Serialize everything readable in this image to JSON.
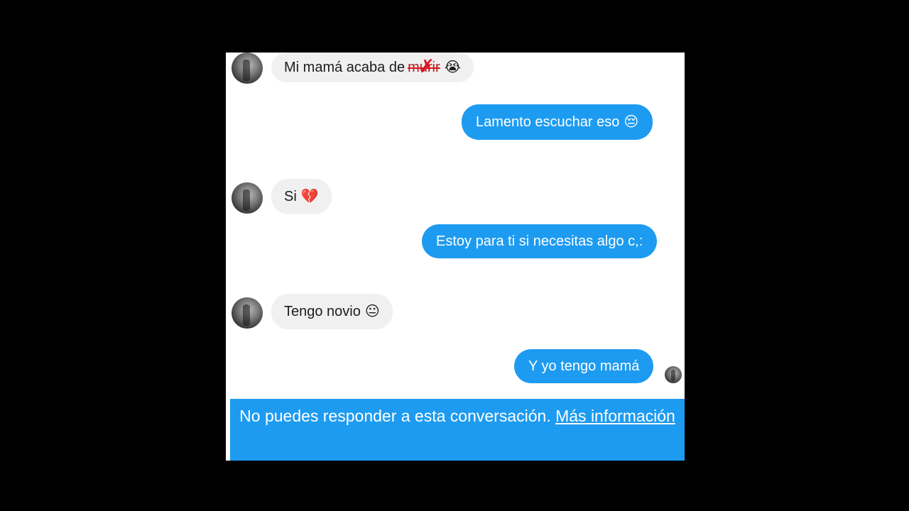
{
  "conversation": {
    "messages": [
      {
        "side": "incoming",
        "text": "Mi mamá acaba de",
        "struck": "murir",
        "emoji": "😭"
      },
      {
        "side": "outgoing",
        "text": "Lamento escuchar eso",
        "emoji": "😔"
      },
      {
        "side": "incoming",
        "text": "Si",
        "emoji": "💔"
      },
      {
        "side": "outgoing",
        "text": "Estoy para ti si necesitas algo c,:",
        "emoji": ""
      },
      {
        "side": "incoming",
        "text": "Tengo novio",
        "emoji": "😐"
      },
      {
        "side": "outgoing",
        "text": "Y yo tengo mamá",
        "emoji": ""
      }
    ]
  },
  "footer": {
    "notice": "No puedes responder a esta conversación.",
    "link": "Más información"
  },
  "colors": {
    "accent": "#1d9bf0",
    "incoming_bubble": "#f0f0f1",
    "background": "#000000"
  }
}
